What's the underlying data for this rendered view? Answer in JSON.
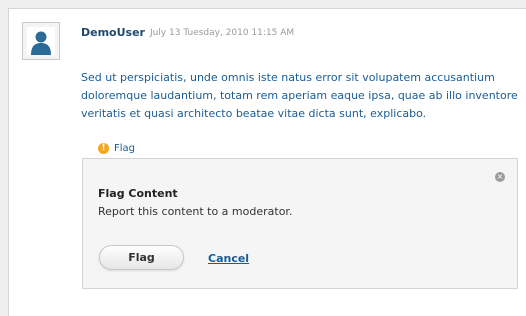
{
  "comment": {
    "author": "DemoUser",
    "timestamp": "July 13 Tuesday, 2010 11:15 AM",
    "body": "Sed ut perspiciatis, unde omnis iste natus error sit volupatem accusantium doloremque laudantium, totam rem aperiam eaque ipsa, quae ab illo inventore veritatis et quasi architecto beatae vitae dicta sunt, explicabo.",
    "flag_icon_glyph": "!",
    "flag_label": "Flag"
  },
  "flag_panel": {
    "title": "Flag Content",
    "description": "Report this content to a moderator.",
    "close_icon_glyph": "×",
    "flag_button_label": "Flag",
    "cancel_label": "Cancel"
  },
  "colors": {
    "link": "#1a5c96",
    "author": "#1f4a6e",
    "avatar": "#2b6a96",
    "flag_icon": "#f3a71d"
  },
  "icons": {
    "avatar": "default-user-avatar",
    "flag": "exclamation-circle-icon",
    "close": "close-circle-icon"
  }
}
